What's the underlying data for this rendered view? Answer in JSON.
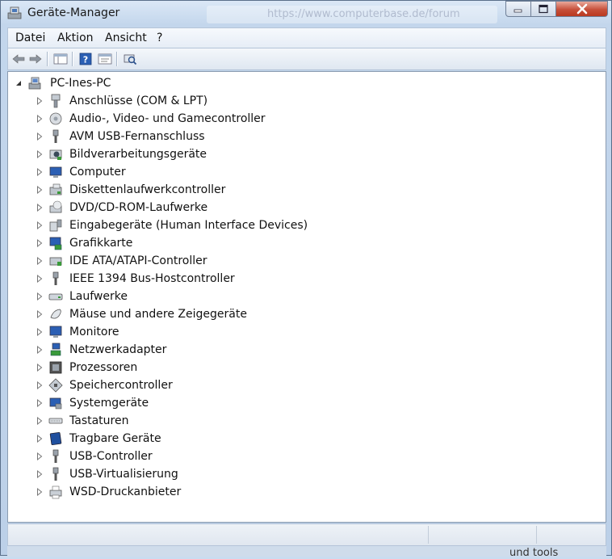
{
  "window": {
    "title": "Geräte-Manager",
    "background_url_text": "https://www.computerbase.de/forum"
  },
  "menu": [
    "Datei",
    "Aktion",
    "Ansicht",
    "?"
  ],
  "toolbar": {
    "buttons": [
      "back-icon",
      "forward-icon",
      "console-tree-icon",
      "help-icon",
      "properties-icon",
      "scan-hardware-icon"
    ]
  },
  "tree": {
    "root": "PC-Ines-PC",
    "categories": [
      {
        "label": "Anschlüsse (COM & LPT)",
        "icon": "port-icon"
      },
      {
        "label": "Audio-, Video- und Gamecontroller",
        "icon": "audio-icon"
      },
      {
        "label": "AVM USB-Fernanschluss",
        "icon": "usb-icon"
      },
      {
        "label": "Bildverarbeitungsgeräte",
        "icon": "camera-icon"
      },
      {
        "label": "Computer",
        "icon": "computer-icon"
      },
      {
        "label": "Diskettenlaufwerkcontroller",
        "icon": "floppy-controller-icon"
      },
      {
        "label": "DVD/CD-ROM-Laufwerke",
        "icon": "dvd-icon"
      },
      {
        "label": "Eingabegeräte (Human Interface Devices)",
        "icon": "hid-icon"
      },
      {
        "label": "Grafikkarte",
        "icon": "display-adapter-icon"
      },
      {
        "label": "IDE ATA/ATAPI-Controller",
        "icon": "ide-icon"
      },
      {
        "label": "IEEE 1394 Bus-Hostcontroller",
        "icon": "firewire-icon"
      },
      {
        "label": "Laufwerke",
        "icon": "disk-drive-icon"
      },
      {
        "label": "Mäuse und andere Zeigegeräte",
        "icon": "mouse-icon"
      },
      {
        "label": "Monitore",
        "icon": "monitor-icon"
      },
      {
        "label": "Netzwerkadapter",
        "icon": "network-icon"
      },
      {
        "label": "Prozessoren",
        "icon": "processor-icon"
      },
      {
        "label": "Speichercontroller",
        "icon": "storage-icon"
      },
      {
        "label": "Systemgeräte",
        "icon": "system-icon"
      },
      {
        "label": "Tastaturen",
        "icon": "keyboard-icon"
      },
      {
        "label": "Tragbare Geräte",
        "icon": "portable-icon"
      },
      {
        "label": "USB-Controller",
        "icon": "usb-icon"
      },
      {
        "label": "USB-Virtualisierung",
        "icon": "usb-icon"
      },
      {
        "label": "WSD-Druckanbieter",
        "icon": "printer-icon"
      }
    ]
  },
  "background_text": "und  tools",
  "colors": {
    "title_close": "#c7503a",
    "tree_bg": "#ffffff",
    "frame": "#c3d6ec"
  }
}
